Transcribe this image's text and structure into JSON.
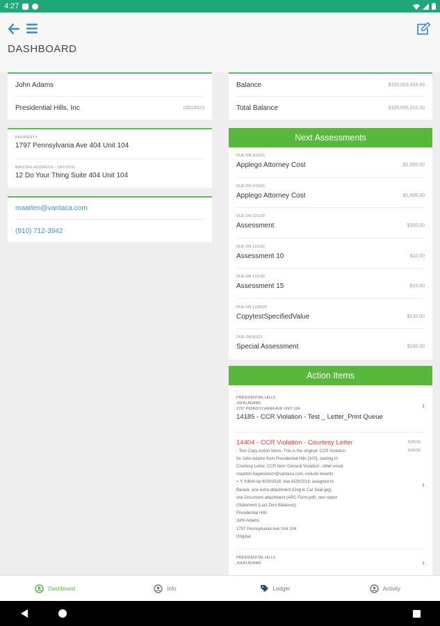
{
  "status_bar": {
    "time": "4:27"
  },
  "header": {
    "title": "DASHBOARD"
  },
  "owner": {
    "name": "John Adams",
    "association": "Presidential Hills, Inc",
    "account_id": "10010023"
  },
  "property": {
    "label": "PROPERTY",
    "address": "1797 Pennsylvania Ave 404 Unit 104",
    "mailing_label": "MAILING ADDRESS - OFFSITE",
    "mailing_address": "12 Do Your Thing Suite 404 Unit 104"
  },
  "contact": {
    "email": "maarten@vantaca.com",
    "phone": "(910) 712-3942"
  },
  "balances": {
    "balance_label": "Balance",
    "balance_value": "$100,003,418.49",
    "total_label": "Total Balance",
    "total_value": "$100,005,010.30"
  },
  "assessments": {
    "title": "Next Assessments",
    "items": [
      {
        "due": "DUE ON 3/15/21",
        "name": "Applego Attorney Cost",
        "amount": "$1,000.00"
      },
      {
        "due": "DUE ON 3/15/21",
        "name": "Applego Attorney Cost",
        "amount": "$1,000.00"
      },
      {
        "due": "DUE ON 11/1/20",
        "name": "Assessment",
        "amount": "$300.00"
      },
      {
        "due": "DUE ON 11/1/20",
        "name": "Assessment 10",
        "amount": "$10.00"
      },
      {
        "due": "DUE ON 11/1/20",
        "name": "Assessment 15",
        "amount": "$15.00"
      },
      {
        "due": "DUE ON 11/30/20",
        "name": "CopytestSpecifiedValue",
        "amount": "$120.00"
      },
      {
        "due": "DUE ON 8/1/21",
        "name": "Special Assessment",
        "amount": "$100.00"
      }
    ]
  },
  "actions": {
    "title": "Action Items",
    "items": [
      {
        "dash": "-",
        "association": "PRESIDENTIAL HILLS",
        "owner": "JOHN ADAMS",
        "address": "1797 PENNSYLVANIA AVE UNIT 104",
        "title": "14185 - CCR Violation - Test _ Letter_Print Queue"
      },
      {
        "title": "14404 - CCR Violation - Courtesy Letter",
        "date1": "5/25/18",
        "date2": "5/20/18",
        "body": [
          "- Test Copy Action Items. This is the original: CCR Violation",
          "for John Adams from Presidential Hills [100], starting in",
          "Courtesy Letter, CCR Item 'General Violation', other email",
          "maarten.hagendoorn@vantaca.com, include tenants",
          "= Y, follow-up 6/29/2018, due 6/29/2018, assigned to",
          "Barack, one extra attachment (Dog in Car Seat.jpg),",
          "one Document attachment (ARC Form.pdf), one report",
          "(Statement (Last Zero Balance)).",
          "Presidential Hills",
          "John Adams",
          "1797 Pennsylvania Ave Unit 104",
          "Original"
        ]
      },
      {
        "association": "PRESIDENTIAL HILLS",
        "owner": "JOHN ADAMS"
      }
    ]
  },
  "nav": {
    "dashboard": "Dashboard",
    "info": "Info",
    "ledger": "Ledger",
    "activity": "Activity"
  },
  "colors": {
    "accent_green": "#58b83b",
    "status_bar": "#1fa67a",
    "link_blue": "#3b8fd6",
    "alert_red": "#e53935"
  }
}
